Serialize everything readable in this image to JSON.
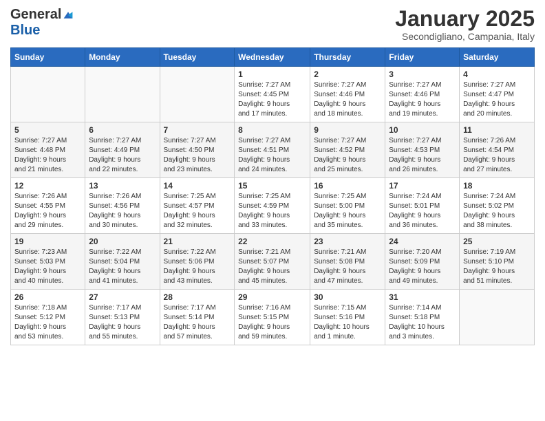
{
  "header": {
    "logo_general": "General",
    "logo_blue": "Blue",
    "month_title": "January 2025",
    "subtitle": "Secondigliano, Campania, Italy"
  },
  "weekdays": [
    "Sunday",
    "Monday",
    "Tuesday",
    "Wednesday",
    "Thursday",
    "Friday",
    "Saturday"
  ],
  "weeks": [
    {
      "days": [
        {
          "number": "",
          "info": ""
        },
        {
          "number": "",
          "info": ""
        },
        {
          "number": "",
          "info": ""
        },
        {
          "number": "1",
          "info": "Sunrise: 7:27 AM\nSunset: 4:45 PM\nDaylight: 9 hours\nand 17 minutes."
        },
        {
          "number": "2",
          "info": "Sunrise: 7:27 AM\nSunset: 4:46 PM\nDaylight: 9 hours\nand 18 minutes."
        },
        {
          "number": "3",
          "info": "Sunrise: 7:27 AM\nSunset: 4:46 PM\nDaylight: 9 hours\nand 19 minutes."
        },
        {
          "number": "4",
          "info": "Sunrise: 7:27 AM\nSunset: 4:47 PM\nDaylight: 9 hours\nand 20 minutes."
        }
      ]
    },
    {
      "days": [
        {
          "number": "5",
          "info": "Sunrise: 7:27 AM\nSunset: 4:48 PM\nDaylight: 9 hours\nand 21 minutes."
        },
        {
          "number": "6",
          "info": "Sunrise: 7:27 AM\nSunset: 4:49 PM\nDaylight: 9 hours\nand 22 minutes."
        },
        {
          "number": "7",
          "info": "Sunrise: 7:27 AM\nSunset: 4:50 PM\nDaylight: 9 hours\nand 23 minutes."
        },
        {
          "number": "8",
          "info": "Sunrise: 7:27 AM\nSunset: 4:51 PM\nDaylight: 9 hours\nand 24 minutes."
        },
        {
          "number": "9",
          "info": "Sunrise: 7:27 AM\nSunset: 4:52 PM\nDaylight: 9 hours\nand 25 minutes."
        },
        {
          "number": "10",
          "info": "Sunrise: 7:27 AM\nSunset: 4:53 PM\nDaylight: 9 hours\nand 26 minutes."
        },
        {
          "number": "11",
          "info": "Sunrise: 7:26 AM\nSunset: 4:54 PM\nDaylight: 9 hours\nand 27 minutes."
        }
      ]
    },
    {
      "days": [
        {
          "number": "12",
          "info": "Sunrise: 7:26 AM\nSunset: 4:55 PM\nDaylight: 9 hours\nand 29 minutes."
        },
        {
          "number": "13",
          "info": "Sunrise: 7:26 AM\nSunset: 4:56 PM\nDaylight: 9 hours\nand 30 minutes."
        },
        {
          "number": "14",
          "info": "Sunrise: 7:25 AM\nSunset: 4:57 PM\nDaylight: 9 hours\nand 32 minutes."
        },
        {
          "number": "15",
          "info": "Sunrise: 7:25 AM\nSunset: 4:59 PM\nDaylight: 9 hours\nand 33 minutes."
        },
        {
          "number": "16",
          "info": "Sunrise: 7:25 AM\nSunset: 5:00 PM\nDaylight: 9 hours\nand 35 minutes."
        },
        {
          "number": "17",
          "info": "Sunrise: 7:24 AM\nSunset: 5:01 PM\nDaylight: 9 hours\nand 36 minutes."
        },
        {
          "number": "18",
          "info": "Sunrise: 7:24 AM\nSunset: 5:02 PM\nDaylight: 9 hours\nand 38 minutes."
        }
      ]
    },
    {
      "days": [
        {
          "number": "19",
          "info": "Sunrise: 7:23 AM\nSunset: 5:03 PM\nDaylight: 9 hours\nand 40 minutes."
        },
        {
          "number": "20",
          "info": "Sunrise: 7:22 AM\nSunset: 5:04 PM\nDaylight: 9 hours\nand 41 minutes."
        },
        {
          "number": "21",
          "info": "Sunrise: 7:22 AM\nSunset: 5:06 PM\nDaylight: 9 hours\nand 43 minutes."
        },
        {
          "number": "22",
          "info": "Sunrise: 7:21 AM\nSunset: 5:07 PM\nDaylight: 9 hours\nand 45 minutes."
        },
        {
          "number": "23",
          "info": "Sunrise: 7:21 AM\nSunset: 5:08 PM\nDaylight: 9 hours\nand 47 minutes."
        },
        {
          "number": "24",
          "info": "Sunrise: 7:20 AM\nSunset: 5:09 PM\nDaylight: 9 hours\nand 49 minutes."
        },
        {
          "number": "25",
          "info": "Sunrise: 7:19 AM\nSunset: 5:10 PM\nDaylight: 9 hours\nand 51 minutes."
        }
      ]
    },
    {
      "days": [
        {
          "number": "26",
          "info": "Sunrise: 7:18 AM\nSunset: 5:12 PM\nDaylight: 9 hours\nand 53 minutes."
        },
        {
          "number": "27",
          "info": "Sunrise: 7:17 AM\nSunset: 5:13 PM\nDaylight: 9 hours\nand 55 minutes."
        },
        {
          "number": "28",
          "info": "Sunrise: 7:17 AM\nSunset: 5:14 PM\nDaylight: 9 hours\nand 57 minutes."
        },
        {
          "number": "29",
          "info": "Sunrise: 7:16 AM\nSunset: 5:15 PM\nDaylight: 9 hours\nand 59 minutes."
        },
        {
          "number": "30",
          "info": "Sunrise: 7:15 AM\nSunset: 5:16 PM\nDaylight: 10 hours\nand 1 minute."
        },
        {
          "number": "31",
          "info": "Sunrise: 7:14 AM\nSunset: 5:18 PM\nDaylight: 10 hours\nand 3 minutes."
        },
        {
          "number": "",
          "info": ""
        }
      ]
    }
  ]
}
